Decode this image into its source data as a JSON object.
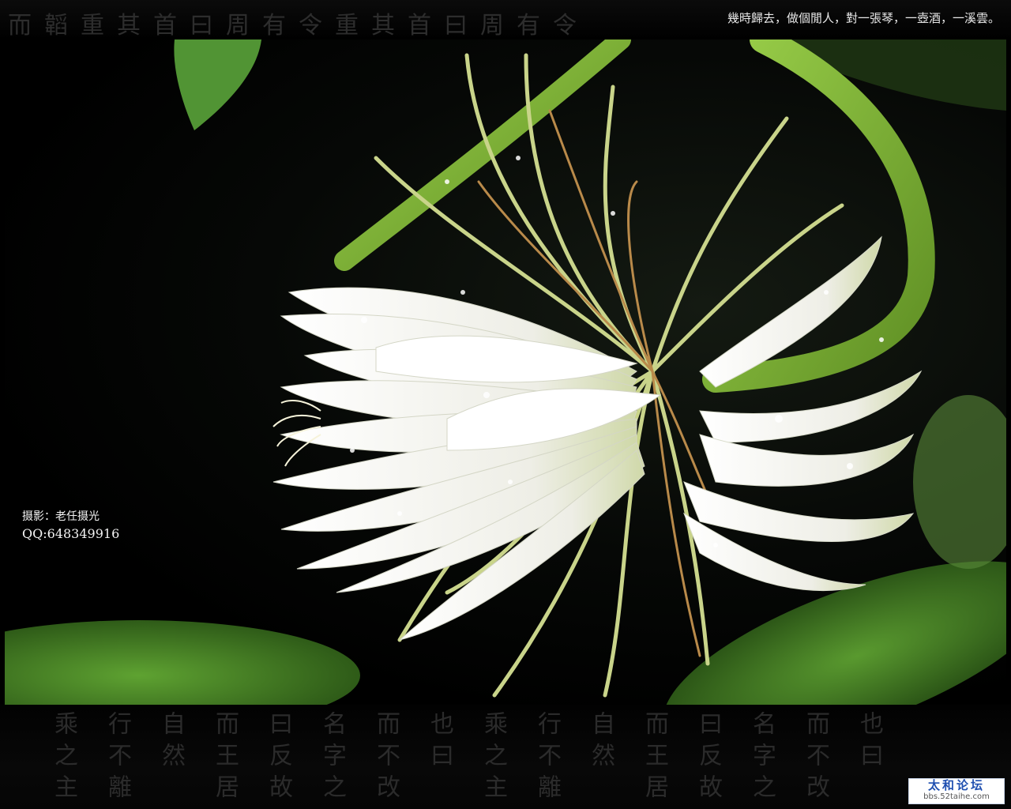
{
  "poem": "幾時歸去，做個閒人，對一張琴，一壺酒，一溪雲。",
  "credit": {
    "line1": "摄影：老任摄光",
    "line2": "QQ:648349916"
  },
  "watermark": {
    "brand": "太和论坛",
    "url": "bbs.52taihe.com"
  },
  "background_calligraphy": {
    "top": "而韜重其首曰周有令重其首曰周有令",
    "bottom_columns": [
      "乘之主",
      "行不離",
      "自然",
      "而王居",
      "曰反故",
      "名字之",
      "而不改",
      "也曰",
      "乘之主",
      "行不離",
      "自然",
      "而王居",
      "曰反故",
      "名字之",
      "而不改",
      "也曰"
    ]
  },
  "colors": {
    "frame": "#000000",
    "calligraphy": "#2d2d2d",
    "petal": "#f4f4ef",
    "stem": "#7fb63a",
    "leaf": "#4f8f2a",
    "logo_blue": "#1f4fb0"
  }
}
